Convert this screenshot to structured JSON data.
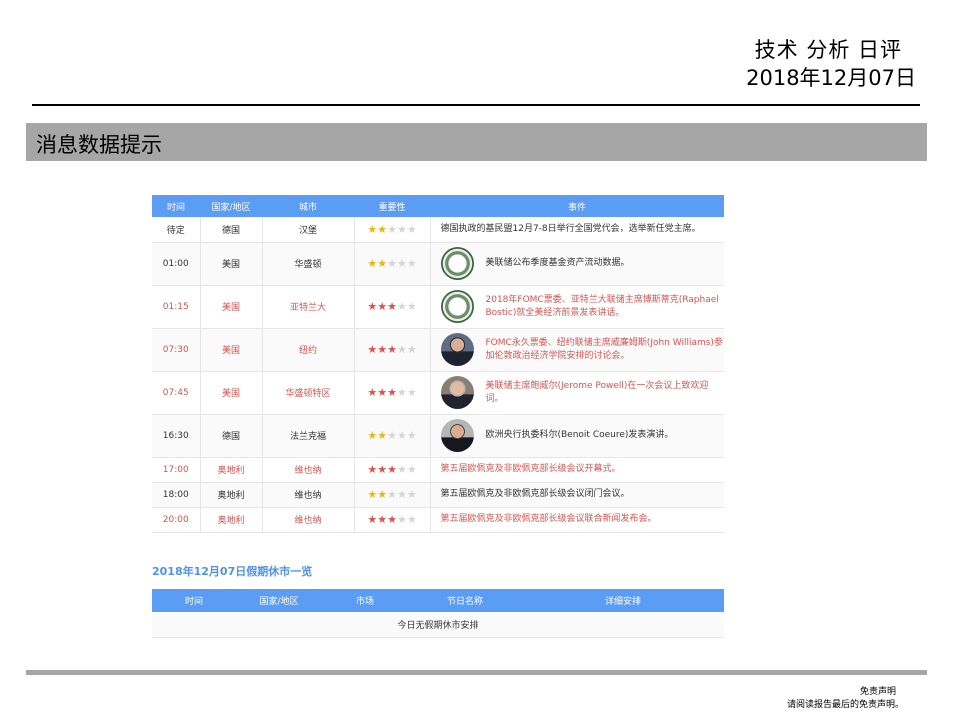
{
  "header": {
    "title": "技术 分析 日评",
    "date": "2018年12月07日"
  },
  "section": {
    "title": "消息数据提示"
  },
  "events_table": {
    "columns": [
      "时间",
      "国家/地区",
      "城市",
      "重要性",
      "事件"
    ],
    "rows": [
      {
        "time": "待定",
        "country": "德国",
        "city": "汉堡",
        "stars": 2,
        "event": "德国执政的基民盟12月7-8日举行全国党代会，选举新任党主席。",
        "avatar": "",
        "highlight": false
      },
      {
        "time": "01:00",
        "country": "美国",
        "city": "华盛顿",
        "stars": 2,
        "event": "美联储公布季度基金资产流动数据。",
        "avatar": "fed-seal-icon",
        "highlight": false
      },
      {
        "time": "01:15",
        "country": "美国",
        "city": "亚特兰大",
        "stars": 3,
        "event": "2018年FOMC票委、亚特兰大联储主席博斯蒂克(Raphael Bostic)就全美经济前景发表讲话。",
        "avatar": "fed-seal-icon",
        "highlight": true
      },
      {
        "time": "07:30",
        "country": "美国",
        "city": "纽约",
        "stars": 3,
        "event": "FOMC永久票委、纽约联储主席威廉姆斯(John Williams)参加伦敦政治经济学院安排的讨论会。",
        "avatar": "portrait-williams",
        "highlight": true
      },
      {
        "time": "07:45",
        "country": "美国",
        "city": "华盛顿特区",
        "stars": 3,
        "event": "美联储主席鲍威尔(Jerome Powell)在一次会议上致欢迎词。",
        "avatar": "portrait-powell",
        "highlight": true
      },
      {
        "time": "16:30",
        "country": "德国",
        "city": "法兰克福",
        "stars": 2,
        "event": "欧洲央行执委科尔(Benoit Coeure)发表演讲。",
        "avatar": "portrait-coeure",
        "highlight": false
      },
      {
        "time": "17:00",
        "country": "奥地利",
        "city": "维也纳",
        "stars": 3,
        "event": "第五届欧佩克及非欧佩克部长级会议开幕式。",
        "avatar": "",
        "highlight": true
      },
      {
        "time": "18:00",
        "country": "奥地利",
        "city": "维也纳",
        "stars": 2,
        "event": "第五届欧佩克及非欧佩克部长级会议闭门会议。",
        "avatar": "",
        "highlight": false
      },
      {
        "time": "20:00",
        "country": "奥地利",
        "city": "维也纳",
        "stars": 3,
        "event": "第五届欧佩克及非欧佩克部长级会议联合新闻发布会。",
        "avatar": "",
        "highlight": true
      }
    ]
  },
  "holiday": {
    "title": "2018年12月07日假期休市一览",
    "columns": [
      "时间",
      "国家/地区",
      "市场",
      "节日名称",
      "详细安排"
    ],
    "empty_text": "今日无假期休市安排"
  },
  "colors": {
    "header_blue": "#5b9cf5",
    "highlight_red": "#d9534f",
    "star_gold": "#e8b618",
    "bar_gray": "#a6a6a6"
  },
  "footer": {
    "disclaimer_title": "免责声明",
    "disclaimer_text": "请阅读报告最后的免责声明。"
  }
}
